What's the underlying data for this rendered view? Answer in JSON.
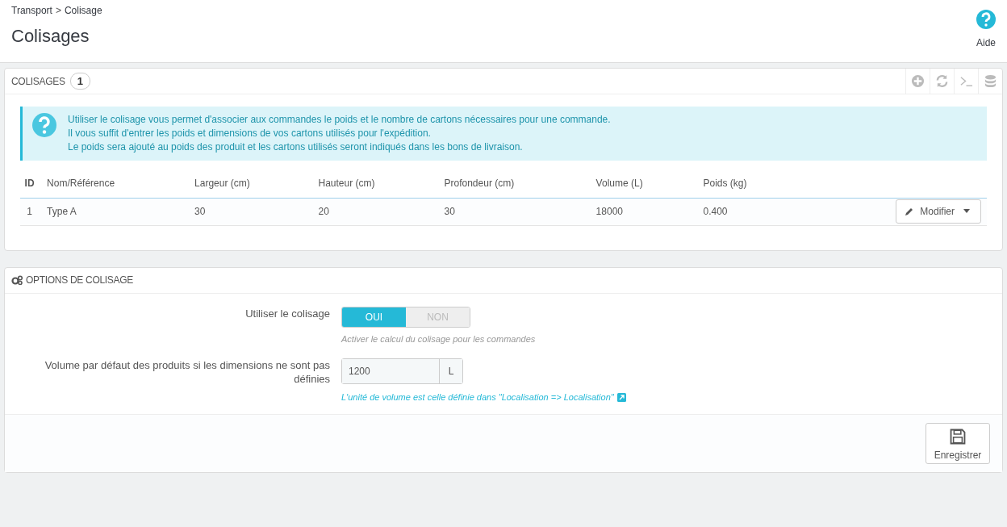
{
  "breadcrumb": {
    "items": [
      "Transport",
      "Colisage"
    ],
    "separator": ">"
  },
  "page_title": "Colisages",
  "help": {
    "label": "Aide"
  },
  "list_panel": {
    "title": "COLISAGES",
    "count": "1",
    "info_lines": [
      "Utiliser le colisage vous permet d'associer aux commandes le poids et le nombre de cartons nécessaires pour une commande.",
      "Il vous suffit d'entrer les poids et dimensions de vos cartons utilisés pour l'expédition.",
      "Le poids sera ajouté au poids des produit et les cartons utilisés seront indiqués dans les bons de livraison."
    ],
    "table": {
      "columns": [
        "ID",
        "Nom/Référence",
        "Largeur (cm)",
        "Hauteur (cm)",
        "Profondeur (cm)",
        "Volume (L)",
        "Poids (kg)"
      ],
      "rows": [
        {
          "cells": [
            "1",
            "Type A",
            "30",
            "20",
            "30",
            "18000",
            "0.400"
          ],
          "action": "Modifier"
        }
      ]
    }
  },
  "options_panel": {
    "title": "OPTIONS DE COLISAGE",
    "fields": [
      {
        "kind": "toggle",
        "label": "Utiliser le colisage",
        "options": [
          {
            "label": "OUI",
            "selected": true
          },
          {
            "label": "NON",
            "selected": false
          }
        ],
        "hint": "Activer le calcul du colisage pour les commandes"
      },
      {
        "kind": "input",
        "label": "Volume par défaut des produits si les dimensions ne sont pas définies",
        "value": "1200",
        "unit": "L",
        "link": "L'unité de volume est celle définie dans \"Localisation => Localisation\""
      }
    ],
    "save_button": "Enregistrer"
  }
}
